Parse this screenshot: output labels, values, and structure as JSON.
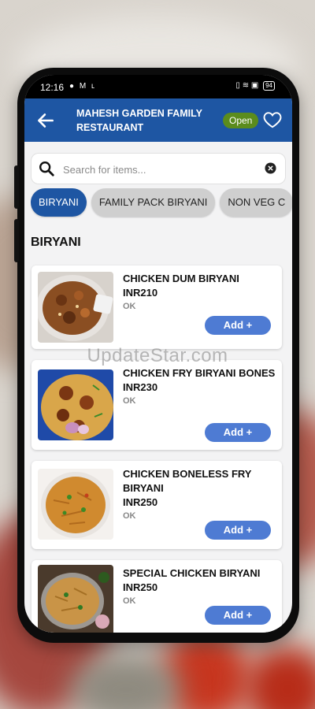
{
  "status_bar": {
    "time": "12:16",
    "battery": "94"
  },
  "header": {
    "title": "MAHESH GARDEN FAMILY RESTAURANT",
    "status_badge": "Open",
    "accent_color": "#1e56a3",
    "badge_color": "#5b8c1d"
  },
  "search": {
    "placeholder": "Search for items..."
  },
  "categories": [
    {
      "label": "BIRYANI",
      "active": true
    },
    {
      "label": "FAMILY PACK BIRYANI",
      "active": false
    },
    {
      "label": "NON VEG C",
      "active": false
    }
  ],
  "section": {
    "title": "BIRYANI"
  },
  "items": [
    {
      "name": "CHICKEN DUM BIRYANI",
      "price": "INR210",
      "veg_label": "OK",
      "add_label": "Add +"
    },
    {
      "name": "CHICKEN FRY BIRYANI BONES",
      "price": "INR230",
      "veg_label": "OK",
      "add_label": "Add +"
    },
    {
      "name": "CHICKEN BONELESS FRY BIRYANI",
      "price": "INR250",
      "veg_label": "OK",
      "add_label": "Add +"
    },
    {
      "name": "SPECIAL CHICKEN BIRYANI",
      "price": "INR250",
      "veg_label": "OK",
      "add_label": "Add +"
    }
  ],
  "watermark": "UpdateStar.com",
  "icons": {
    "back": "arrow-left-icon",
    "favorite": "heart-icon",
    "search": "search-icon",
    "clear": "clear-icon"
  }
}
